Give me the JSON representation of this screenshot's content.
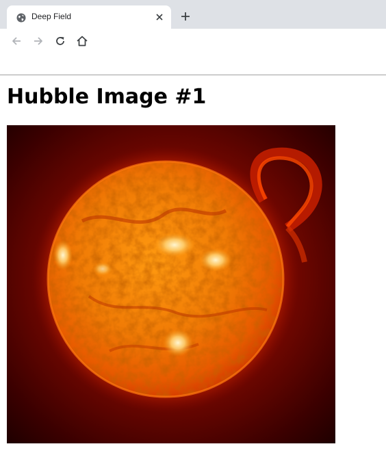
{
  "tab": {
    "title": "Deep Field",
    "favicon": "globe-icon",
    "close_icon": "close-icon"
  },
  "new_tab_icon": "plus-icon",
  "toolbar": {
    "back_icon": "arrow-left-icon",
    "forward_icon": "arrow-right-icon",
    "reload_icon": "reload-icon",
    "home_icon": "home-icon"
  },
  "page": {
    "heading": "Hubble Image #1",
    "image_subject": "sun with solar prominence"
  },
  "colors": {
    "tabstrip_bg": "#dee1e6",
    "sun_core": "#ff9a10",
    "sun_edge": "#d43a00",
    "space_bg": "#2a0000"
  }
}
